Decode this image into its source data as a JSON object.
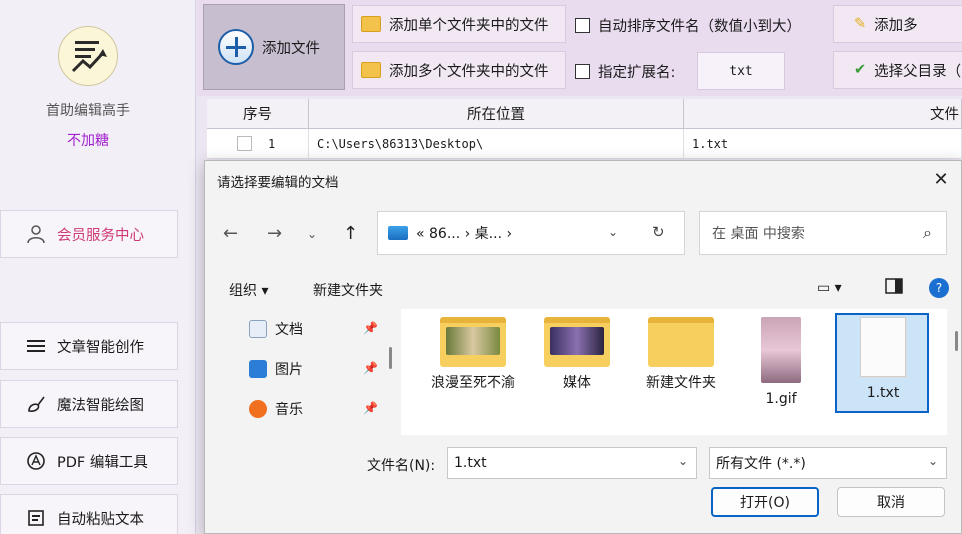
{
  "sidebar": {
    "app_name": "首助编辑高手",
    "app_sub": "不加糖",
    "vip_label": "会员服务中心",
    "items": [
      {
        "label": "文章智能创作"
      },
      {
        "label": "魔法智能绘图"
      },
      {
        "label": "PDF 编辑工具"
      },
      {
        "label": "自动粘贴文本"
      }
    ]
  },
  "toolbar": {
    "add_file": "添加文件",
    "add_single_folder": "添加单个文件夹中的文件",
    "add_multi_folder": "添加多个文件夹中的文件",
    "auto_sort": "自动排序文件名（数值小到大）",
    "specify_ext": "指定扩展名:",
    "ext_value": "txt",
    "add_more": "添加多",
    "choose_parent": "选择父目录（"
  },
  "table": {
    "headers": [
      "序号",
      "所在位置",
      "文件"
    ],
    "rows": [
      {
        "index": "1",
        "location": "C:\\Users\\86313\\Desktop\\",
        "file": "1.txt"
      }
    ]
  },
  "dialog": {
    "title": "请选择要编辑的文档",
    "breadcrumb": "« 86... › 桌... ›",
    "search_placeholder": "在 桌面 中搜索",
    "organize": "组织 ▾",
    "new_folder": "新建文件夹",
    "nav_items": [
      {
        "label": "文档",
        "icon": "document-icon"
      },
      {
        "label": "图片",
        "icon": "pictures-icon"
      },
      {
        "label": "音乐",
        "icon": "music-icon"
      }
    ],
    "files": [
      {
        "name": "浪漫至死不渝",
        "type": "folder"
      },
      {
        "name": "媒体",
        "type": "folder"
      },
      {
        "name": "新建文件夹",
        "type": "folder"
      },
      {
        "name": "1.gif",
        "type": "gif"
      },
      {
        "name": "1.txt",
        "type": "txt",
        "selected": true
      }
    ],
    "filename_label": "文件名(N):",
    "filename_value": "1.txt",
    "filetype_value": "所有文件 (*.*)",
    "open_label": "打开(O)",
    "cancel_label": "取消"
  },
  "colors": {
    "accent": "#0a64c8",
    "vip": "#d03a78",
    "sub": "#a022cc"
  }
}
